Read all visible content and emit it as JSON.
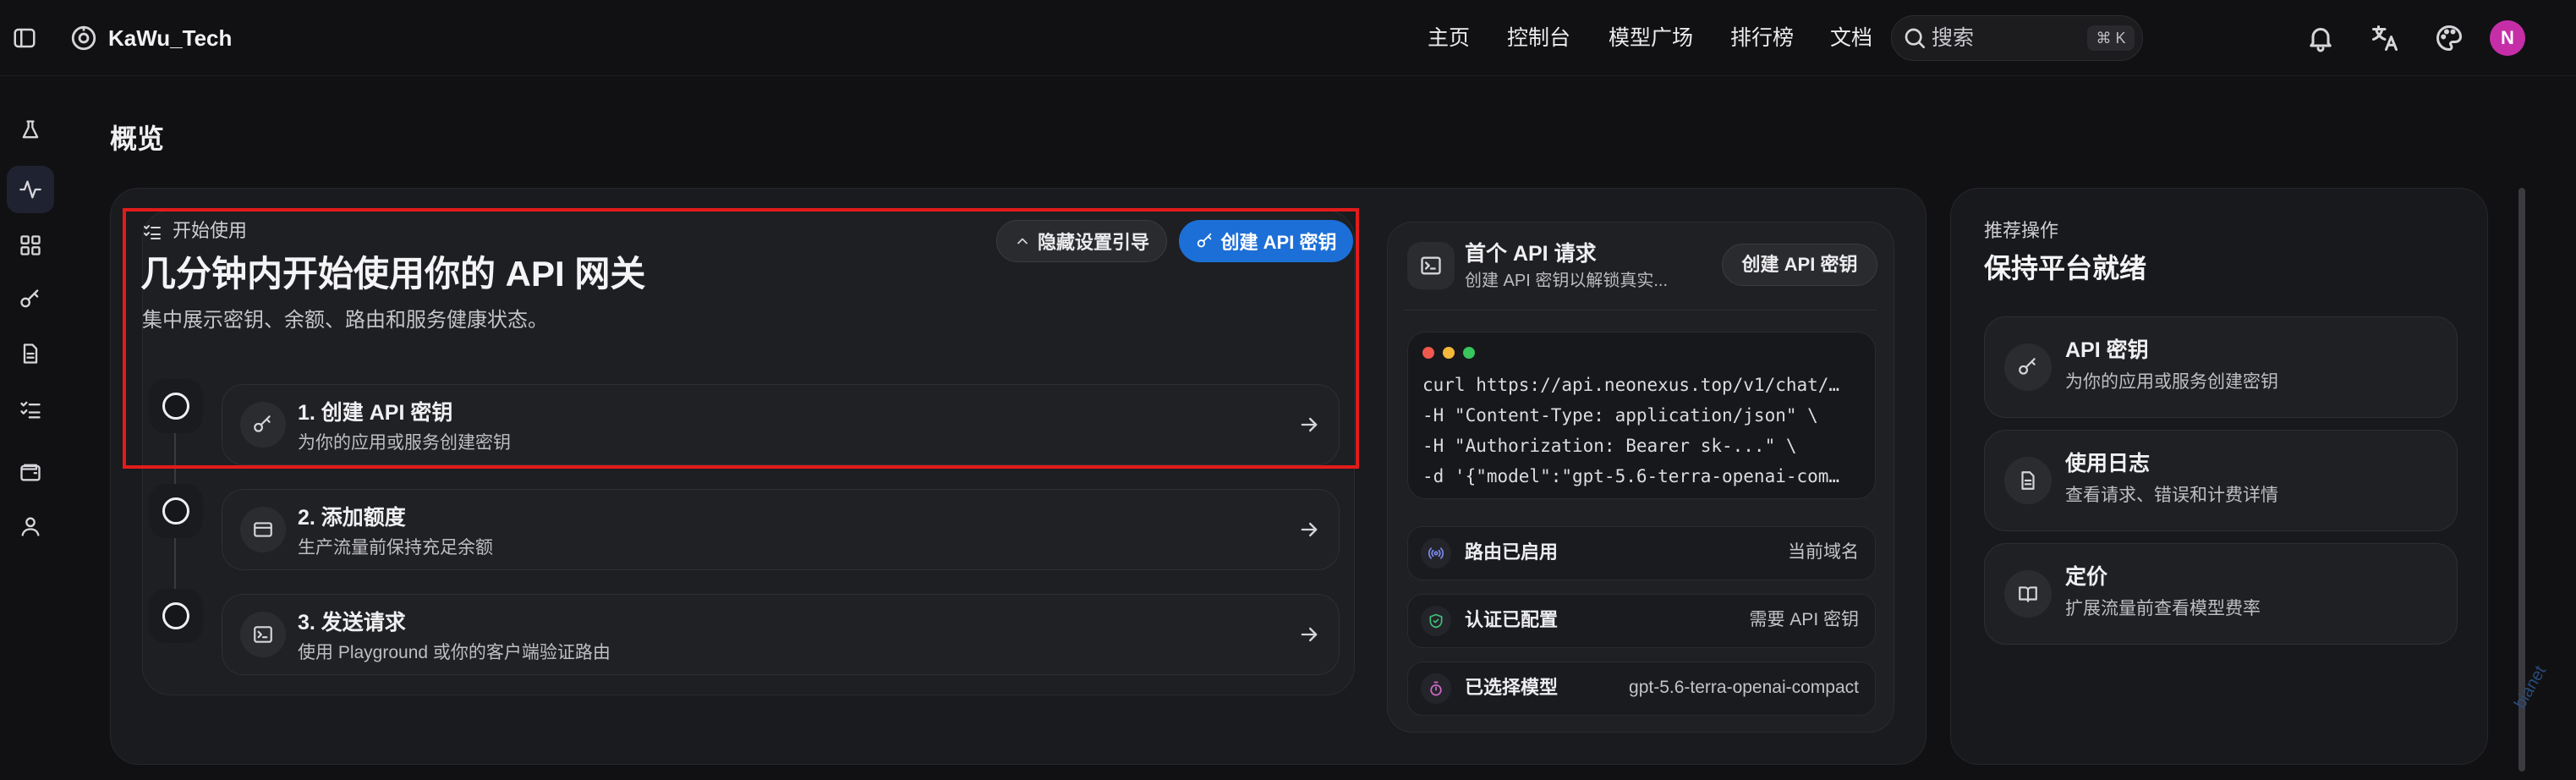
{
  "brand": {
    "name": "KaWu_Tech"
  },
  "nav": {
    "items": [
      "主页",
      "控制台",
      "模型广场",
      "排行榜",
      "文档"
    ]
  },
  "search": {
    "placeholder": "搜索",
    "shortcut": "⌘ K"
  },
  "user": {
    "avatar_initial": "N"
  },
  "page": {
    "title": "概览"
  },
  "onboarding": {
    "eyebrow": "开始使用",
    "title": "几分钟内开始使用你的 API 网关",
    "subtitle": "集中展示密钥、余额、路由和服务健康状态。",
    "hide_button": "隐藏设置引导",
    "create_button": "创建 API 密钥",
    "steps": [
      {
        "title": "1. 创建 API 密钥",
        "subtitle": "为你的应用或服务创建密钥",
        "icon": "key-icon"
      },
      {
        "title": "2. 添加额度",
        "subtitle": "生产流量前保持充足余额",
        "icon": "credit-card-icon"
      },
      {
        "title": "3. 发送请求",
        "subtitle": "使用 Playground 或你的客户端验证路由",
        "icon": "terminal-icon"
      }
    ]
  },
  "first_request": {
    "title": "首个 API 请求",
    "subtitle": "创建 API 密钥以解锁真实...",
    "button": "创建 API 密钥",
    "code": [
      "curl https://api.neonexus.top/v1/chat/…",
      "-H \"Content-Type: application/json\" \\",
      "-H \"Authorization: Bearer sk-...\" \\",
      "-d '{\"model\":\"gpt-5.6-terra-openai-com…"
    ],
    "status": [
      {
        "label": "路由已启用",
        "value": "当前域名",
        "icon": "signal-icon",
        "color": "#7c8cf0"
      },
      {
        "label": "认证已配置",
        "value": "需要 API 密钥",
        "icon": "shield-check-icon",
        "color": "#3fc27a"
      },
      {
        "label": "已选择模型",
        "value": "gpt-5.6-terra-openai-compact",
        "icon": "timer-icon",
        "color": "#d46ad0"
      }
    ]
  },
  "recommended": {
    "eyebrow": "推荐操作",
    "title": "保持平台就绪",
    "actions": [
      {
        "title": "API 密钥",
        "subtitle": "为你的应用或服务创建密钥",
        "icon": "key-icon"
      },
      {
        "title": "使用日志",
        "subtitle": "查看请求、错误和计费详情",
        "icon": "document-icon"
      },
      {
        "title": "定价",
        "subtitle": "扩展流量前查看模型费率",
        "icon": "book-icon"
      }
    ]
  },
  "watermark": "bianet"
}
